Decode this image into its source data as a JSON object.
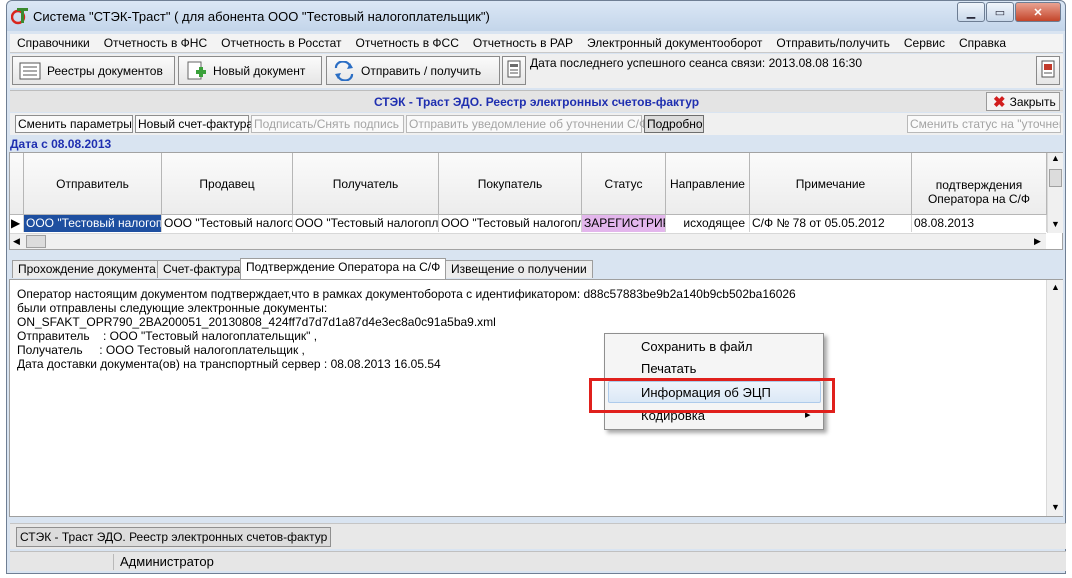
{
  "window": {
    "title": "Система \"СТЭК-Траст\" ( для абонента ООО \"Тестовый налогоплательщик\")",
    "minimize_glyph": "▁",
    "maximize_glyph": "▭",
    "close_glyph": "✕"
  },
  "menubar": {
    "items": [
      "Справочники",
      "Отчетность в ФНС",
      "Отчетность в Росстат",
      "Отчетность в ФСС",
      "Отчетность в РАР",
      "Электронный документооборот",
      "Отправить/получить",
      "Сервис",
      "Справка"
    ]
  },
  "toolbar": {
    "registers_label": "Реестры документов",
    "new_doc_label": "Новый документ",
    "send_receive_label": "Отправить / получить",
    "last_session_text": "Дата последнего успешного сеанса связи: 2013.08.08 16:30"
  },
  "panel": {
    "title": "СТЭК - Траст ЭДО. Реестр электронных счетов-фактур",
    "close_label": "Закрыть"
  },
  "actions": {
    "change_params": "Сменить параметры",
    "new_invoice": "Новый счет-фактура",
    "sign_unsign": "Подписать/Снять подпись",
    "send_clarification": "Отправить уведомление об уточнении С/Ф",
    "details": "Подробно",
    "change_status": "Сменить статус на \"уточнен\""
  },
  "filter": {
    "date_label": "Дата с 08.08.2013"
  },
  "grid": {
    "columns": [
      "Отправитель",
      "Продавец",
      "Получатель",
      "Покупатель",
      "Статус",
      "Направление",
      "Примечание",
      "подтверждения Оператора на С/Ф"
    ],
    "row": {
      "sender": "ООО \"Тестовый налогоплательщик\"",
      "seller": "ООО \"Тестовый налогоплательщик\"",
      "receiver": "ООО \"Тестовый налогоплательщик\"",
      "buyer": "ООО \"Тестовый налогоплательщик\"",
      "status": "ЗАРЕГИСТРИРОВАН",
      "direction": "исходящее",
      "note": "С/Ф № 78 от 05.05.2012",
      "confirm_date": "08.08.2013"
    },
    "status_color": "#e3b6ec"
  },
  "tabs": [
    "Прохождение документа",
    "Счет-фактура",
    "Подтверждение Оператора на С/Ф",
    "Извещение о получении"
  ],
  "active_tab": "Подтверждение Оператора на С/Ф",
  "document_text": [
    "Оператор настоящим документом подтверждает,что в рамках документоборота с идентификатором: d88c57883be9b2a140b9cb502ba16026",
    "были отправлены следующие электронные документы:",
    "ON_SFAKT_OPR790_2BA200051_20130808_424ff7d7d7d1a87d4e3ec8a0c91a5ba9.xml",
    "Отправитель    : ООО \"Тестовый налогоплательщик\" ,",
    "Получатель     : ООО Тестовый налогоплательщик ,",
    "Дата доставки документа(ов) на транспортный сервер : 08.08.2013 16.05.54"
  ],
  "context_menu": {
    "items": [
      "Сохранить в файл",
      "Печатать",
      "Информация об ЭЦП",
      "Кодировка"
    ],
    "submenu_arrow": "▸",
    "highlight_color": "#e0201c"
  },
  "taskbar": {
    "window_button": "СТЭК - Траст ЭДО. Реестр электронных счетов-фактур"
  },
  "statusbar": {
    "user": "Администратор"
  }
}
